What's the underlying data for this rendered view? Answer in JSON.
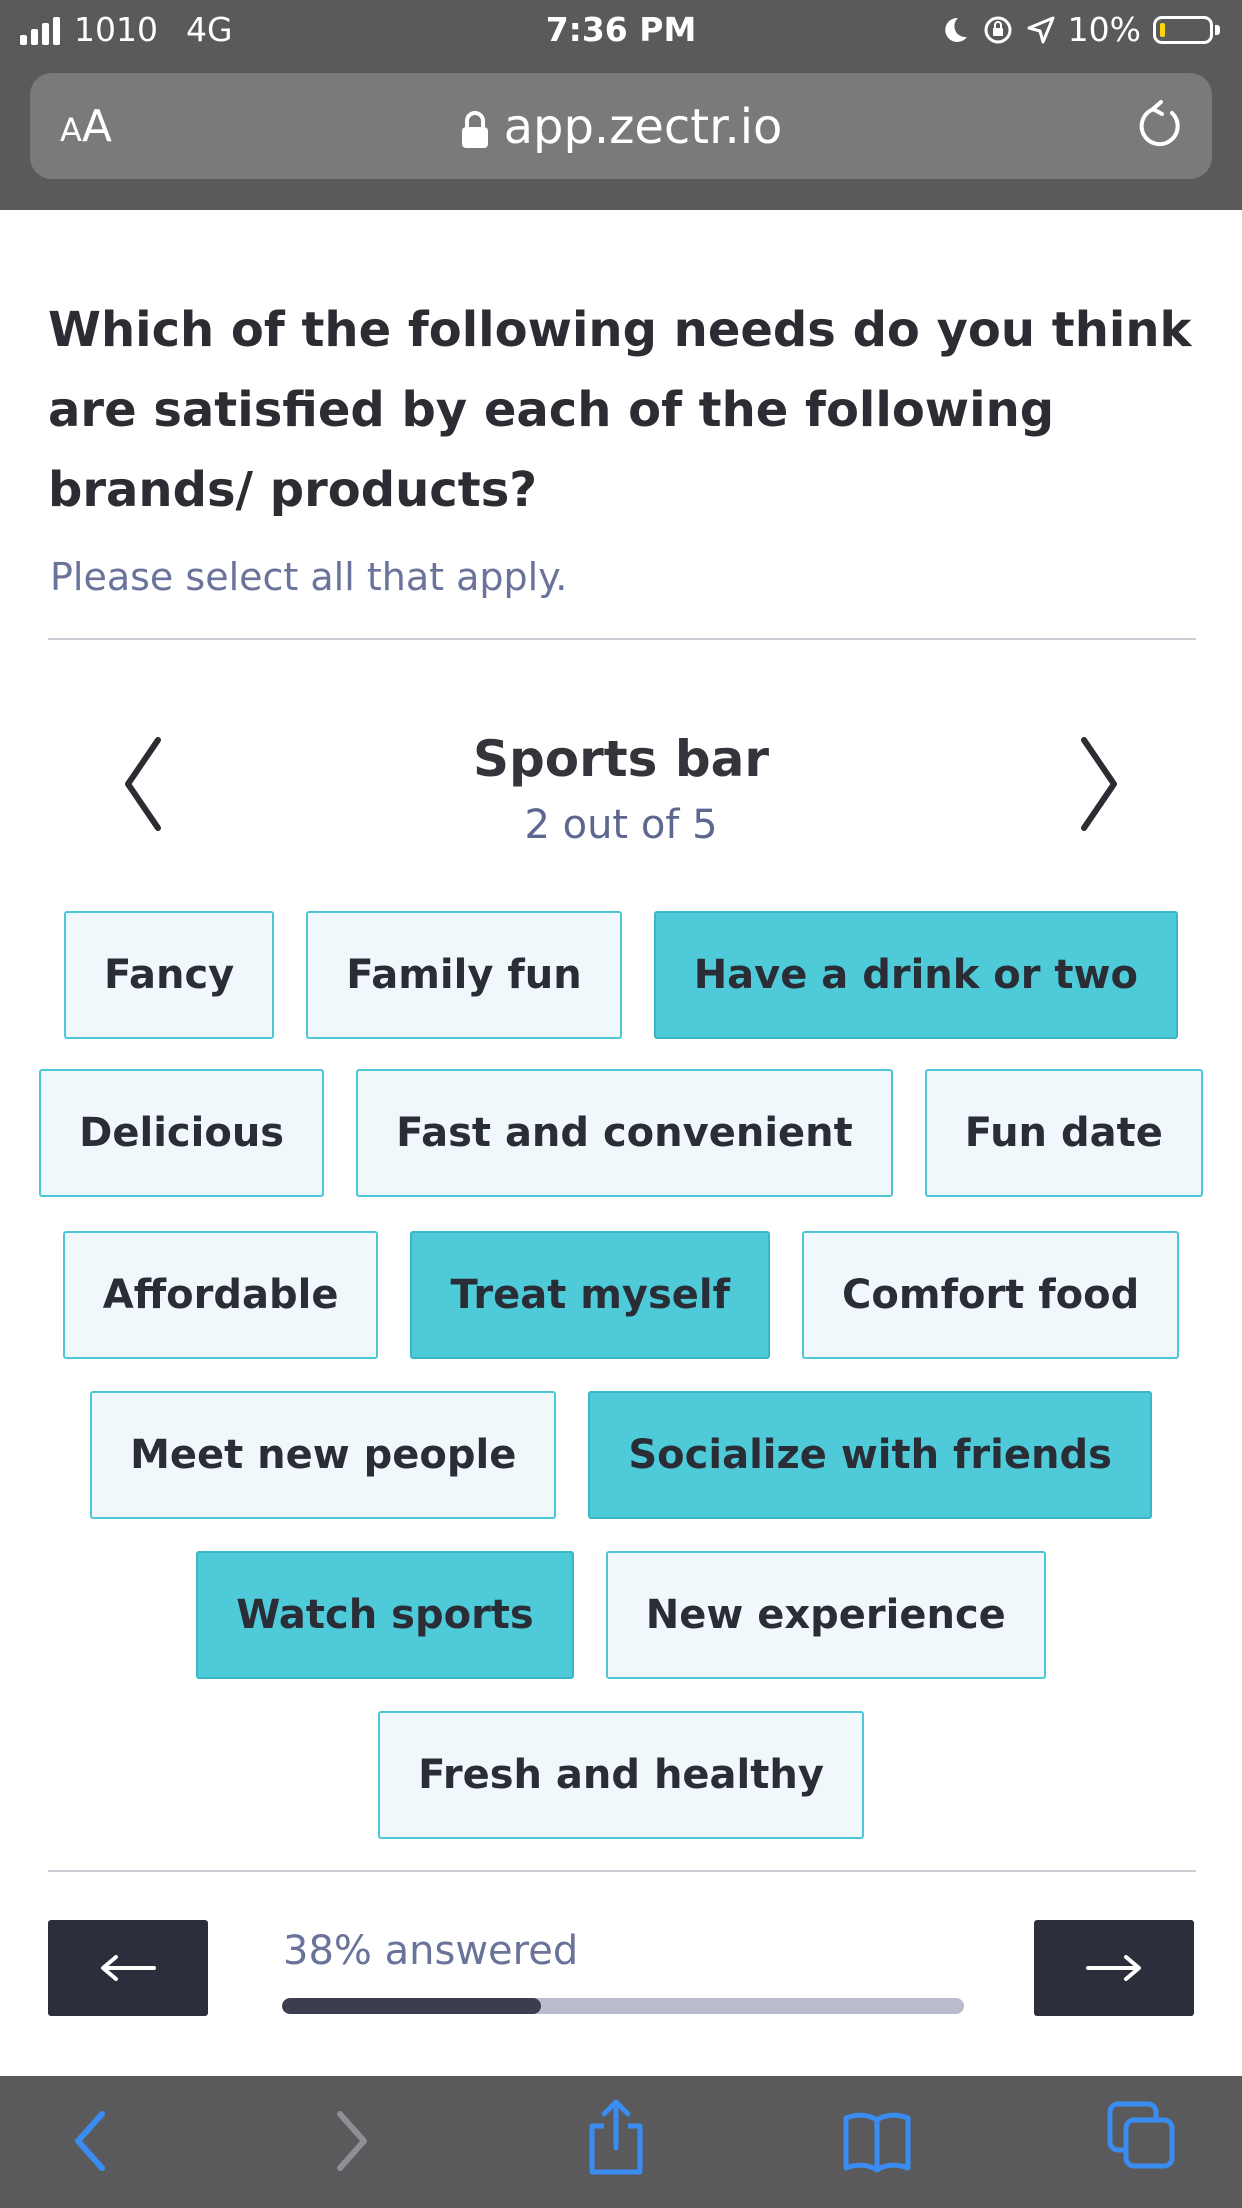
{
  "status_bar": {
    "carrier": "1010",
    "network": "4G",
    "time": "7:36 PM",
    "battery": "10%"
  },
  "browser": {
    "aa_small": "A",
    "aa_large": "A",
    "url": "app.zectr.io"
  },
  "survey": {
    "question": "Which of the following needs do you think are satisfied by each of the following brands/ products?",
    "instructions": "Please select all that apply.",
    "item_name": "Sports bar",
    "item_progress": "2 out of 5",
    "options": [
      {
        "label": "Fancy",
        "selected": false
      },
      {
        "label": "Family fun",
        "selected": false
      },
      {
        "label": "Have a drink or two",
        "selected": true
      },
      {
        "label": "Delicious",
        "selected": false
      },
      {
        "label": "Fast and convenient",
        "selected": false
      },
      {
        "label": "Fun date",
        "selected": false
      },
      {
        "label": "Affordable",
        "selected": false
      },
      {
        "label": "Treat myself",
        "selected": true
      },
      {
        "label": "Comfort food",
        "selected": false
      },
      {
        "label": "Meet new people",
        "selected": false
      },
      {
        "label": "Socialize with friends",
        "selected": true
      },
      {
        "label": "Watch sports",
        "selected": true
      },
      {
        "label": "New experience",
        "selected": false
      },
      {
        "label": "Fresh and healthy",
        "selected": false
      }
    ]
  },
  "footer": {
    "answered_text": "38% answered",
    "answered_fraction": 0.38,
    "prev_icon": "arrow-left-icon",
    "next_icon": "arrow-right-icon"
  },
  "colors": {
    "selected": "#4ecad9",
    "unselected": "#f1f8fb",
    "border": "#4dc7d6",
    "accent_toolbar": "#3a8cf0",
    "dark_button": "#2c2f3b"
  },
  "toolbar": {
    "icons": [
      "back-icon",
      "forward-icon",
      "share-icon",
      "bookmarks-icon",
      "tabs-icon"
    ]
  }
}
